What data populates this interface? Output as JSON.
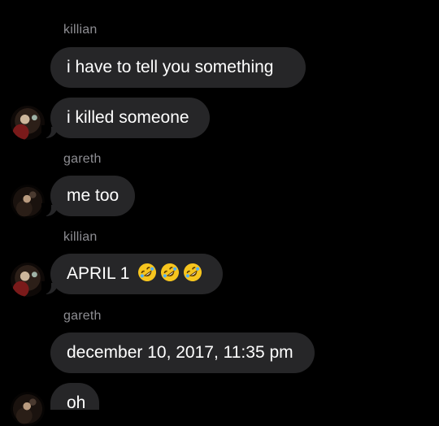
{
  "messages": [
    {
      "sender": "killian",
      "text": "i have to tell you something"
    },
    {
      "text": "i killed someone"
    },
    {
      "sender": "gareth",
      "text": "me too"
    },
    {
      "sender": "killian",
      "text": "APRIL 1",
      "emoji": [
        "rolling-on-floor-laughing-emoji",
        "rolling-on-floor-laughing-emoji",
        "rolling-on-floor-laughing-emoji"
      ]
    },
    {
      "sender": "gareth",
      "text": "december 10, 2017, 11:35 pm"
    },
    {
      "text": "oh"
    }
  ],
  "colors": {
    "background": "#000000",
    "bubble": "#262628",
    "sender_name": "#8e8e93",
    "text": "#ffffff"
  }
}
